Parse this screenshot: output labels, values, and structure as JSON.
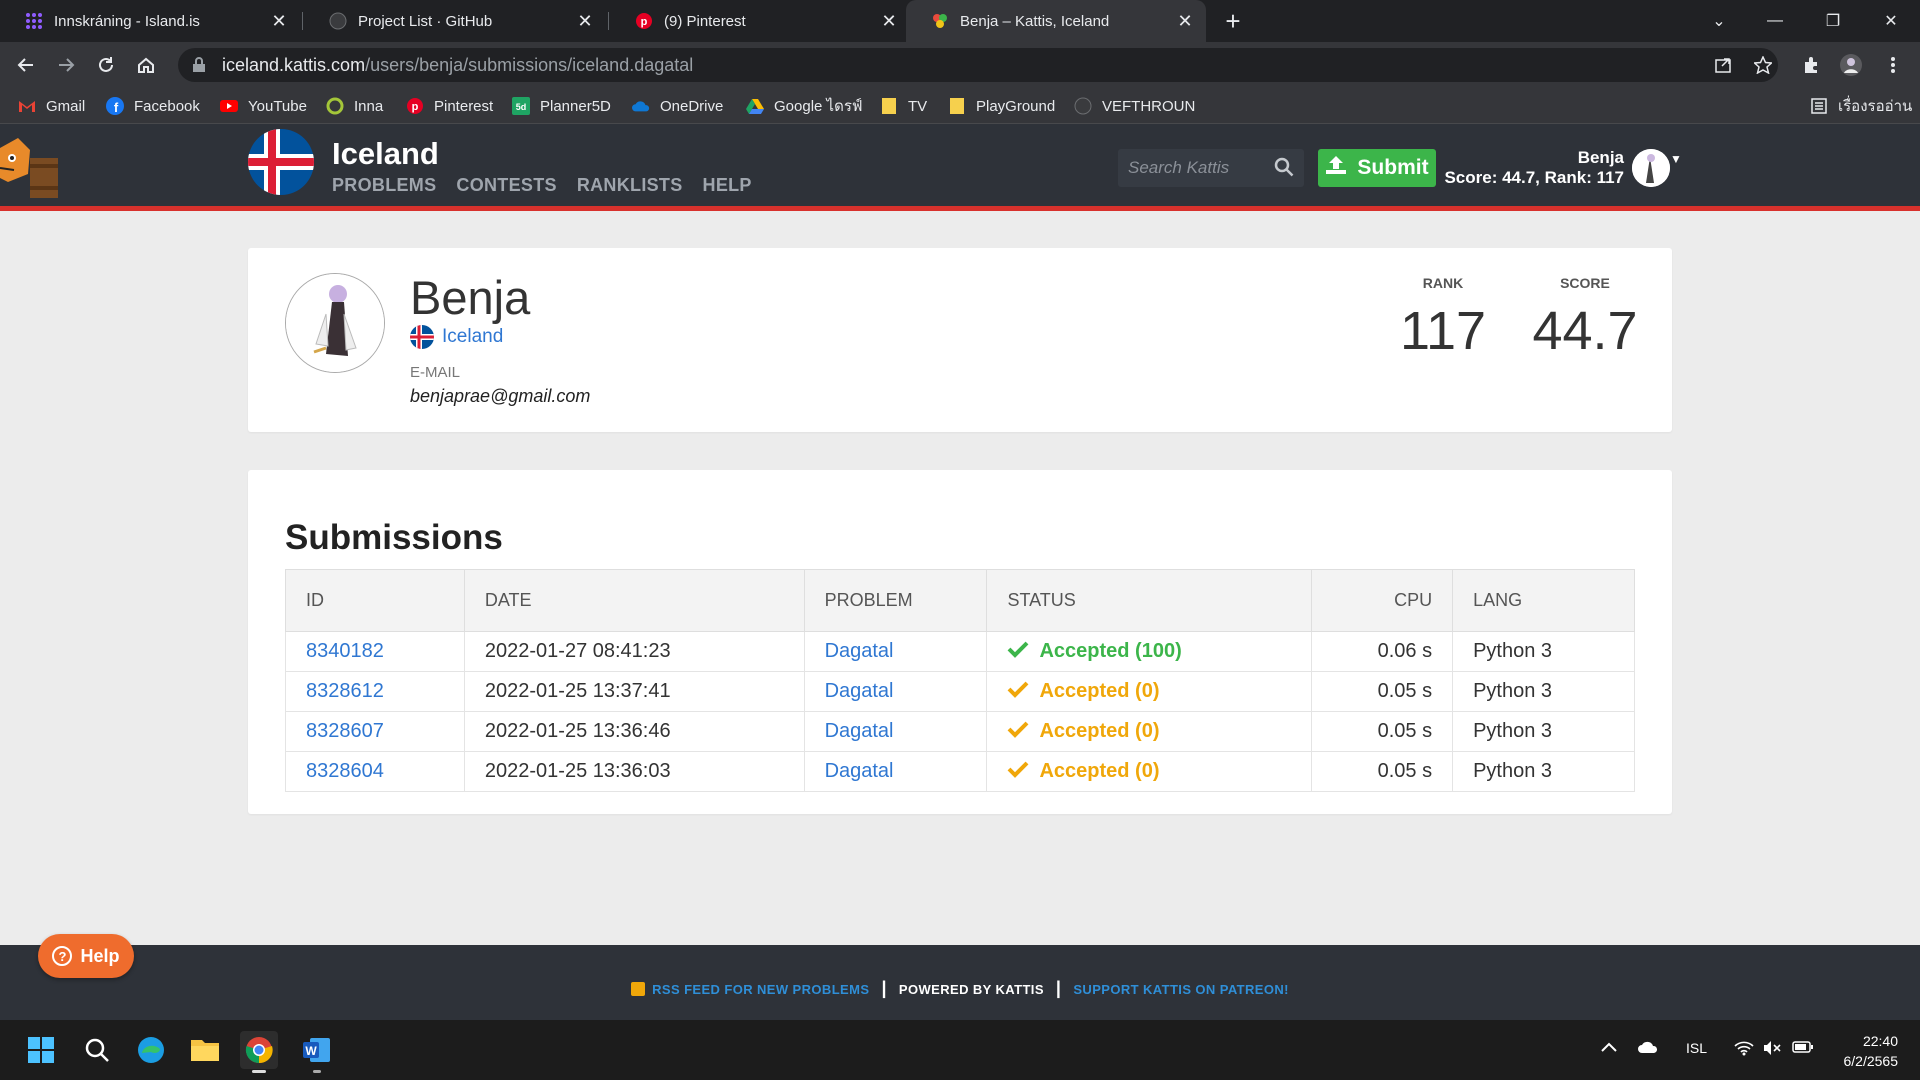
{
  "browser": {
    "tabs": [
      {
        "title": "Innskráning - Island.is",
        "icon": "island-is-icon"
      },
      {
        "title": "Project List · GitHub",
        "icon": "github-icon"
      },
      {
        "title": "(9) Pinterest",
        "icon": "pinterest-icon"
      },
      {
        "title": "Benja – Kattis, Iceland",
        "icon": "kattis-icon"
      }
    ],
    "address": {
      "host": "iceland.kattis.com",
      "path": "/users/benja/submissions/iceland.dagatal"
    },
    "bookmarks": [
      {
        "label": "Gmail",
        "icon": "gmail-icon"
      },
      {
        "label": "Facebook",
        "icon": "facebook-icon"
      },
      {
        "label": "YouTube",
        "icon": "youtube-icon"
      },
      {
        "label": "Inna",
        "icon": "inna-icon"
      },
      {
        "label": "Pinterest",
        "icon": "pinterest-icon"
      },
      {
        "label": "Planner5D",
        "icon": "planner5d-icon"
      },
      {
        "label": "OneDrive",
        "icon": "onedrive-icon"
      },
      {
        "label": "Google ไดรฟ์",
        "icon": "google-drive-icon"
      },
      {
        "label": "TV",
        "icon": "folder-icon"
      },
      {
        "label": "PlayGround",
        "icon": "folder-icon"
      },
      {
        "label": "VEFTHROUN",
        "icon": "github-icon"
      }
    ],
    "reading_list": "เรื่องรออ่าน"
  },
  "kattis": {
    "site_title": "Iceland",
    "nav": [
      "PROBLEMS",
      "CONTESTS",
      "RANKLISTS",
      "HELP"
    ],
    "search_placeholder": "Search Kattis",
    "submit_label": "Submit",
    "user_name": "Benja",
    "user_stats": "Score: 44.7, Rank: 117"
  },
  "profile": {
    "name": "Benja",
    "country": "Iceland",
    "email_label": "E-MAIL",
    "email": "benjaprae@gmail.com",
    "rank_label": "RANK",
    "rank": "117",
    "score_label": "SCORE",
    "score": "44.7"
  },
  "submissions": {
    "title": "Submissions",
    "columns": [
      "ID",
      "DATE",
      "PROBLEM",
      "STATUS",
      "CPU",
      "LANG"
    ],
    "rows": [
      {
        "id": "8340182",
        "date": "2022-01-27 08:41:23",
        "problem": "Dagatal",
        "status": "Accepted (100)",
        "status_kind": "full",
        "cpu": "0.06 s",
        "lang": "Python 3"
      },
      {
        "id": "8328612",
        "date": "2022-01-25 13:37:41",
        "problem": "Dagatal",
        "status": "Accepted (0)",
        "status_kind": "partial",
        "cpu": "0.05 s",
        "lang": "Python 3"
      },
      {
        "id": "8328607",
        "date": "2022-01-25 13:36:46",
        "problem": "Dagatal",
        "status": "Accepted (0)",
        "status_kind": "partial",
        "cpu": "0.05 s",
        "lang": "Python 3"
      },
      {
        "id": "8328604",
        "date": "2022-01-25 13:36:03",
        "problem": "Dagatal",
        "status": "Accepted (0)",
        "status_kind": "partial",
        "cpu": "0.05 s",
        "lang": "Python 3"
      }
    ]
  },
  "footer": {
    "rss": "RSS FEED FOR NEW PROBLEMS",
    "powered": "POWERED BY KATTIS",
    "patreon": "SUPPORT KATTIS ON PATREON!"
  },
  "help_label": "Help",
  "taskbar": {
    "lang": "ISL",
    "time": "22:40",
    "date": "6/2/2565"
  },
  "colors": {
    "accent_blue": "#2f77d2",
    "accepted_green": "#3cb54a",
    "partial_orange": "#f0a70a",
    "header_dark": "#2e3239",
    "header_red": "#d8312c",
    "help_orange": "#ef6c2d"
  }
}
